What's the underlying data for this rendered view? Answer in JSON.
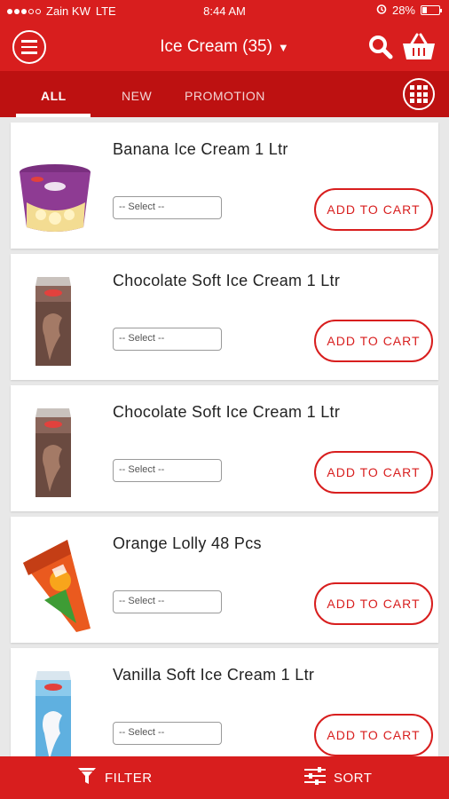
{
  "status_bar": {
    "carrier": "Zain KW",
    "network": "LTE",
    "time": "8:44 AM",
    "battery": "28%",
    "battery_level": 0.28
  },
  "header": {
    "title": "Ice Cream (35)",
    "caret": "▼",
    "menu_icon": "hamburger-menu-icon",
    "search_icon": "search-icon",
    "cart_icon": "basket-icon"
  },
  "tabs": {
    "items": [
      {
        "label": "ALL",
        "active": true
      },
      {
        "label": "NEW",
        "active": false
      },
      {
        "label": "PROMOTION",
        "active": false
      }
    ],
    "grid_icon": "grid-view-icon"
  },
  "products": [
    {
      "name": "Banana Ice Cream 1 Ltr",
      "select_placeholder": "-- Select --",
      "cta": "ADD TO CART",
      "image": "banana-tub-image"
    },
    {
      "name": "Chocolate Soft Ice Cream 1 Ltr",
      "select_placeholder": "-- Select --",
      "cta": "ADD TO CART",
      "image": "chocolate-carton-image"
    },
    {
      "name": "Chocolate Soft Ice Cream 1 Ltr",
      "select_placeholder": "-- Select --",
      "cta": "ADD TO CART",
      "image": "chocolate-carton-image"
    },
    {
      "name": "Orange Lolly 48 Pcs",
      "select_placeholder": "-- Select --",
      "cta": "ADD TO CART",
      "image": "orange-lolly-image"
    },
    {
      "name": "Vanilla Soft Ice Cream 1 Ltr",
      "select_placeholder": "-- Select --",
      "cta": "ADD TO CART",
      "image": "vanilla-carton-image"
    }
  ],
  "bottom_bar": {
    "filter_label": "FILTER",
    "sort_label": "SORT"
  },
  "colors": {
    "brand_red": "#d81e1e",
    "tab_bar_red": "#bd1111"
  }
}
